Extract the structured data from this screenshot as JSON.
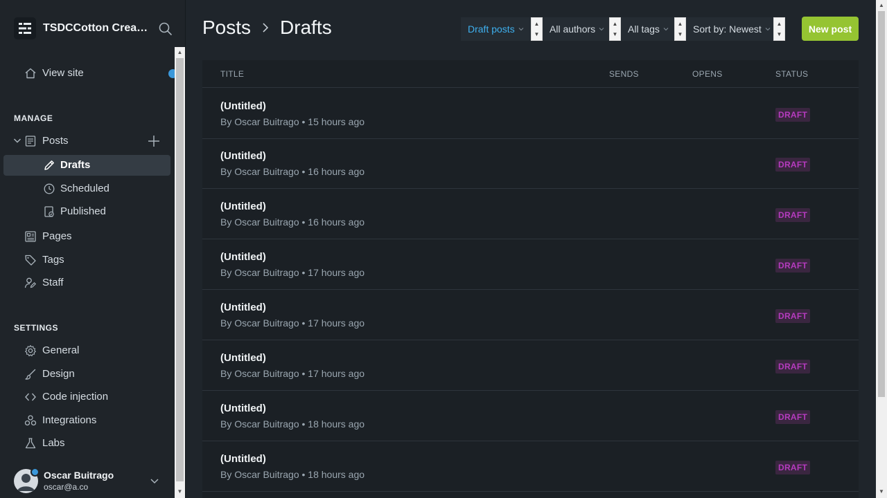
{
  "sidebar": {
    "site_title": "TSDCCotton Creati...",
    "view_site": "View site",
    "manage_heading": "MANAGE",
    "posts": "Posts",
    "drafts": "Drafts",
    "scheduled": "Scheduled",
    "published": "Published",
    "pages": "Pages",
    "tags": "Tags",
    "staff": "Staff",
    "settings_heading": "SETTINGS",
    "general": "General",
    "design": "Design",
    "code_injection": "Code injection",
    "integrations": "Integrations",
    "labs": "Labs",
    "user": {
      "name": "Oscar Buitrago",
      "email": "oscar@a.co"
    }
  },
  "header": {
    "breadcrumb_parent": "Posts",
    "breadcrumb_current": "Drafts",
    "filters": {
      "type": "Draft posts",
      "author": "All authors",
      "tag": "All tags",
      "sort": "Sort by: Newest"
    },
    "new_post": "New post"
  },
  "table": {
    "columns": {
      "title": "TITLE",
      "sends": "SENDS",
      "opens": "OPENS",
      "status": "STATUS"
    },
    "rows": [
      {
        "title": "(Untitled)",
        "meta": "By Oscar Buitrago • 15 hours ago",
        "status": "DRAFT"
      },
      {
        "title": "(Untitled)",
        "meta": "By Oscar Buitrago • 16 hours ago",
        "status": "DRAFT"
      },
      {
        "title": "(Untitled)",
        "meta": "By Oscar Buitrago • 16 hours ago",
        "status": "DRAFT"
      },
      {
        "title": "(Untitled)",
        "meta": "By Oscar Buitrago • 17 hours ago",
        "status": "DRAFT"
      },
      {
        "title": "(Untitled)",
        "meta": "By Oscar Buitrago • 17 hours ago",
        "status": "DRAFT"
      },
      {
        "title": "(Untitled)",
        "meta": "By Oscar Buitrago • 17 hours ago",
        "status": "DRAFT"
      },
      {
        "title": "(Untitled)",
        "meta": "By Oscar Buitrago • 18 hours ago",
        "status": "DRAFT"
      },
      {
        "title": "(Untitled)",
        "meta": "By Oscar Buitrago • 18 hours ago",
        "status": "DRAFT"
      }
    ]
  },
  "colors": {
    "accent_blue": "#3eb0ef",
    "new_post_green": "#95c432",
    "draft_badge_text": "#b63bbf",
    "draft_badge_bg": "#3a2640"
  }
}
